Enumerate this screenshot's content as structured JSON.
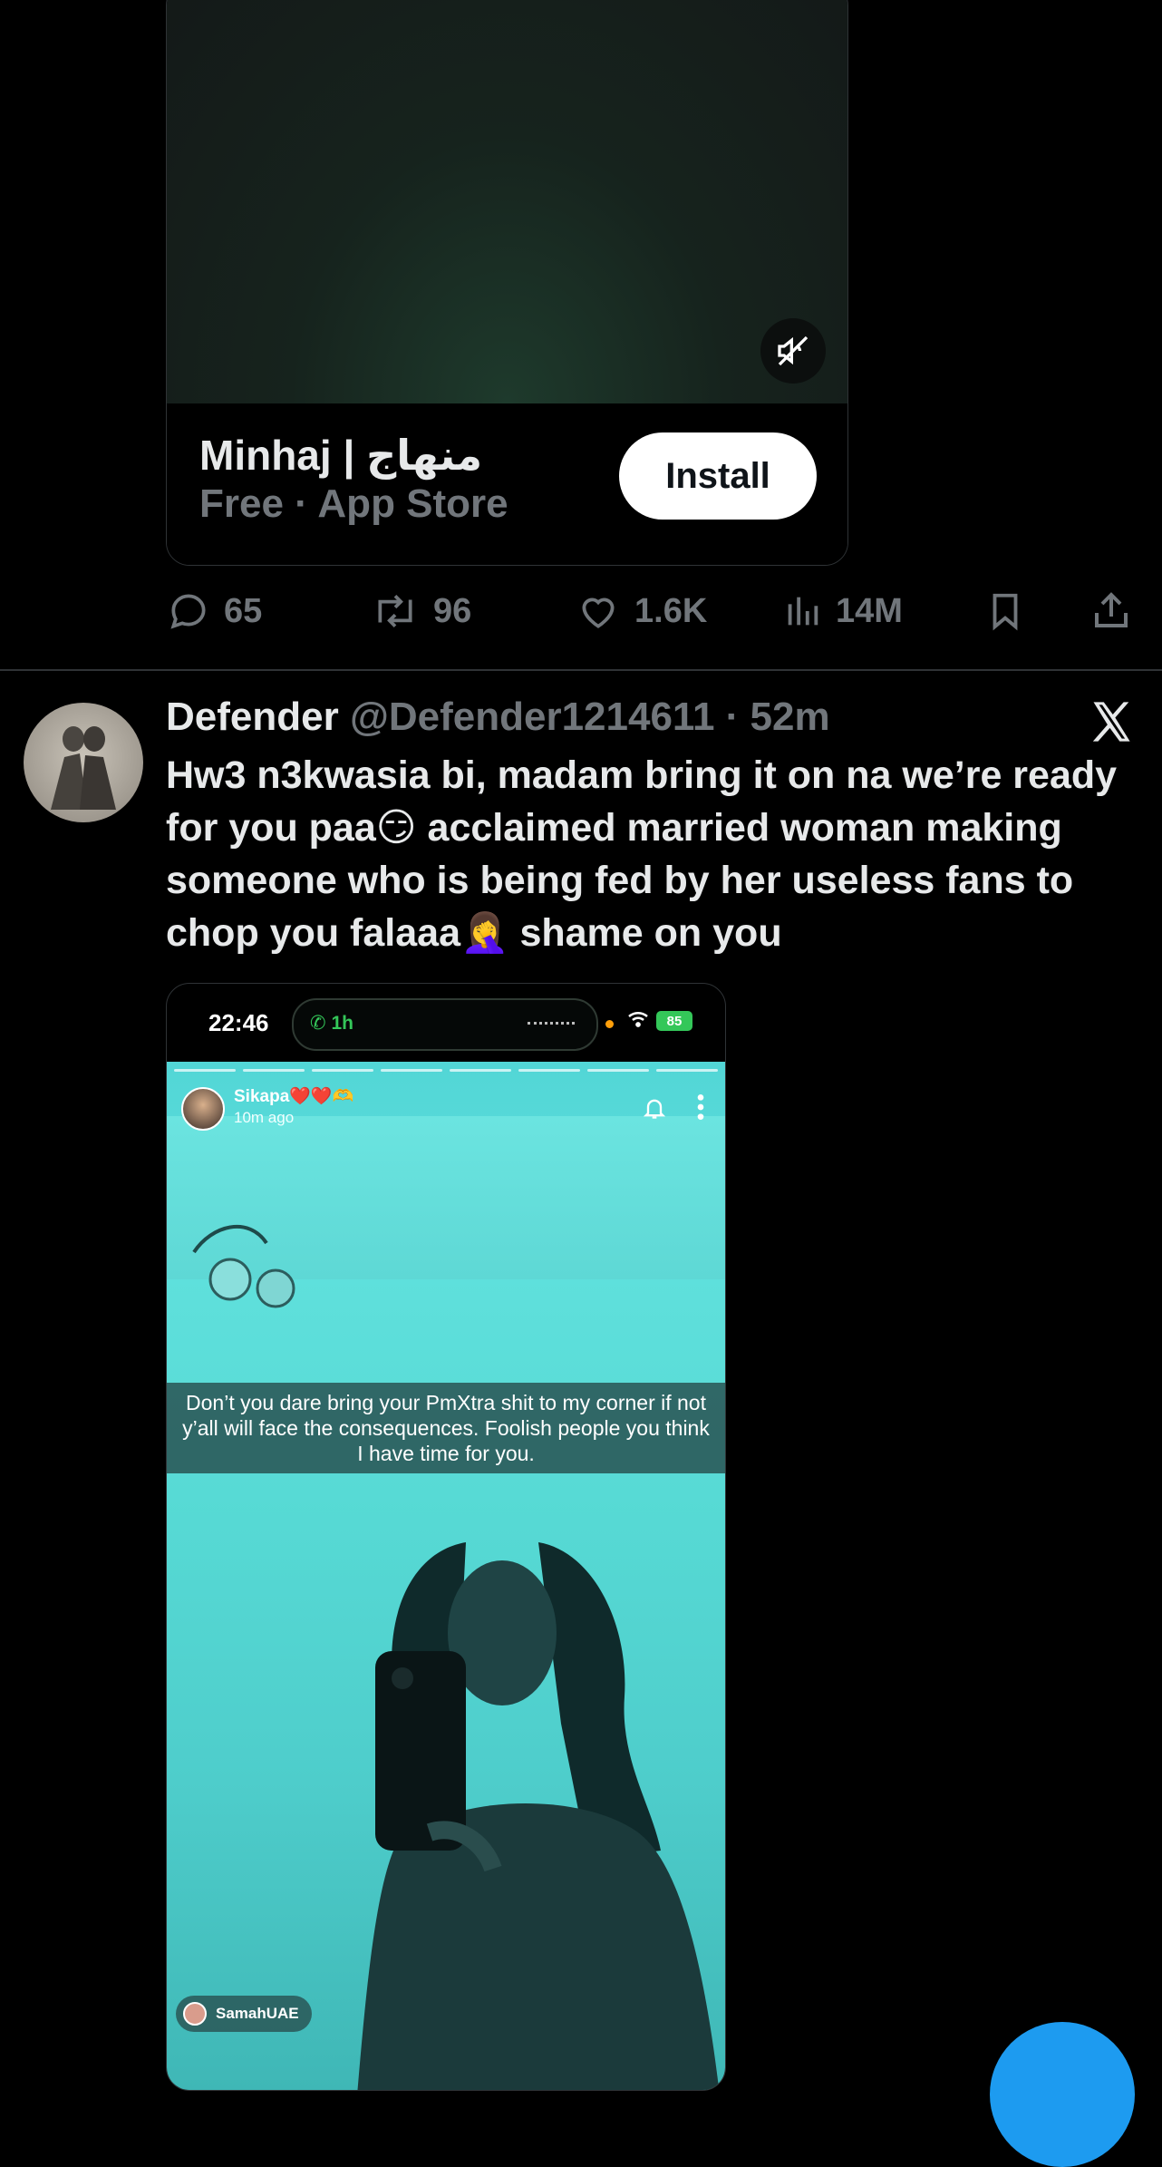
{
  "ad": {
    "app_name": "Minhaj | منهاج",
    "app_meta": "Free · App Store",
    "install_label": "Install"
  },
  "ad_actions": {
    "replies": "65",
    "reposts": "96",
    "likes": "1.6K",
    "views": "14M"
  },
  "tweet": {
    "display_name": "Defender",
    "handle_time": "@Defender1214611 · 52m",
    "text": "Hw3 n3kwasia bi, madam bring it on na we’re ready for you paa😏 acclaimed married woman making someone who is being fed by her useless fans to chop you falaaa🤦‍♀️ shame on you"
  },
  "screenshot": {
    "status_time": "22:46",
    "call_duration": "1h",
    "battery": "85",
    "story_user": "Sikapa❤️❤️🫶",
    "story_time": "10m ago",
    "caption": "Don’t you dare bring your PmXtra shit to my corner if not y’all will face the consequences. Foolish people you think I have time for you.",
    "mention_tag": "SamahUAE"
  },
  "colors": {
    "background": "#000000",
    "secondary_text": "#71767b",
    "accent": "#1d9bf0"
  }
}
